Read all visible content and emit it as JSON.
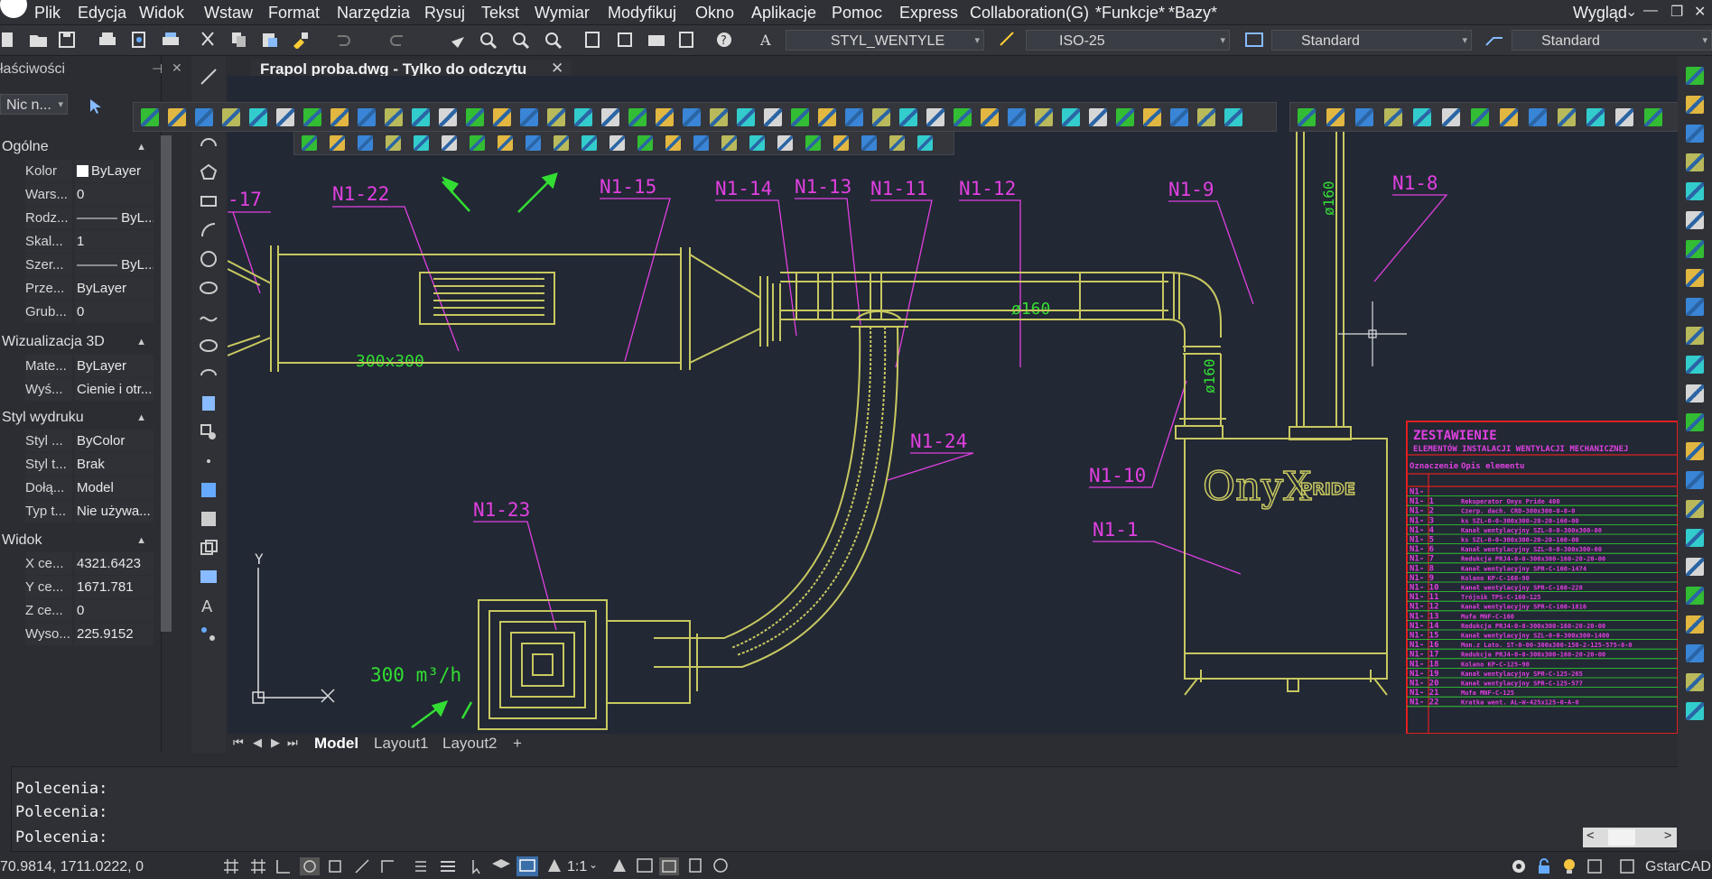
{
  "menu": {
    "items": [
      "Plik",
      "Edycja",
      "Widok",
      "Wstaw",
      "Format",
      "Narzędzia",
      "Rysuj",
      "Tekst",
      "Wymiar",
      "Modyfikuj",
      "Okno",
      "Aplikacje",
      "Pomoc",
      "Express",
      "Collaboration(G)",
      "*Funkcje*",
      "*Bazy*"
    ],
    "right": "Wygląd"
  },
  "toolbar": {
    "text_style": "STYL_WENTYLE",
    "dim_style": "ISO-25",
    "table_style": "Standard",
    "multileader_style": "Standard"
  },
  "document_tab": {
    "title": "Frapol  proba.dwg - Tylko do odczytu"
  },
  "properties": {
    "title": "łaściwości",
    "selection": "Nic n...",
    "sections": [
      {
        "name": "Ogólne",
        "rows": [
          {
            "k": "Kolor",
            "v": "ByLayer"
          },
          {
            "k": "Wars...",
            "v": "0"
          },
          {
            "k": "Rodz...",
            "v": "——— ByL..."
          },
          {
            "k": "Skal...",
            "v": "1"
          },
          {
            "k": "Szer...",
            "v": "——— ByL..."
          },
          {
            "k": "Prze...",
            "v": "ByLayer"
          },
          {
            "k": "Grub...",
            "v": "0"
          }
        ]
      },
      {
        "name": "Wizualizacja 3D",
        "rows": [
          {
            "k": "Mate...",
            "v": "ByLayer"
          },
          {
            "k": "Wyś...",
            "v": "Cienie i otr..."
          }
        ]
      },
      {
        "name": "Styl wydruku",
        "rows": [
          {
            "k": "Styl ...",
            "v": "ByColor"
          },
          {
            "k": "Styl t...",
            "v": "Brak"
          },
          {
            "k": "Dołą...",
            "v": "Model"
          },
          {
            "k": "Typ t...",
            "v": "Nie używa..."
          }
        ]
      },
      {
        "name": "Widok",
        "rows": [
          {
            "k": "X ce...",
            "v": "4321.6423"
          },
          {
            "k": "Y ce...",
            "v": "1671.781"
          },
          {
            "k": "Z ce...",
            "v": "0"
          },
          {
            "k": "Wyso...",
            "v": "225.9152"
          }
        ]
      }
    ]
  },
  "drawing": {
    "labels": {
      "n17": "-17",
      "n22": "N1-22",
      "n15": "N1-15",
      "n14": "N1-14",
      "n13": "N1-13",
      "n11": "N1-11",
      "n12": "N1-12",
      "n9": "N1-9",
      "n8": "N1-8",
      "n24": "N1-24",
      "n23": "N1-23",
      "n10": "N1-10",
      "n1": "N1-1"
    },
    "dims": {
      "duct1": "300x300",
      "d160a": "ø160",
      "d160b": "ø160",
      "d160c": "ø160",
      "flow": "300 m³/h"
    },
    "brand": {
      "a": "OnyX",
      "b": "PRIDE"
    },
    "axes": {
      "y": "Y"
    },
    "table": {
      "title": "ZESTAWIENIE",
      "subtitle": "ELEMENTÓW INSTALACJI WENTYLACJI MECHANICZNEJ",
      "head_a": "Oznaczenie",
      "head_b": "Opis elementu",
      "rows": [
        {
          "id": "N1-",
          "desc": ""
        },
        {
          "id": "N1- 1",
          "desc": "Rekuperator Onyx Pride 400"
        },
        {
          "id": "N1- 2",
          "desc": "Czerp. dach. CRD-300x300-0-0-0"
        },
        {
          "id": "N1- 3",
          "desc": "ks SZL-0-0-300x300-20-20-160-00"
        },
        {
          "id": "N1- 4",
          "desc": "Kanał wentylacyjny SZL-0-0-300x300-00"
        },
        {
          "id": "N1- 5",
          "desc": "ks SZL-0-0-300x300-20-20-160-00"
        },
        {
          "id": "N1- 6",
          "desc": "Kanał wentylacyjny SZL-0-0-300x300-00"
        },
        {
          "id": "N1- 7",
          "desc": "Redukcja PRJ4-0-0-300x300-160-20-20-00"
        },
        {
          "id": "N1- 8",
          "desc": "Kanał wentylacyjny SPR-C-160-1474"
        },
        {
          "id": "N1- 9",
          "desc": "Kolano KP-C-160-90"
        },
        {
          "id": "N1- 10",
          "desc": "Kanał wentylacyjny SPR-C-160-228"
        },
        {
          "id": "N1- 11",
          "desc": "Trójnik TPS-C-160-125"
        },
        {
          "id": "N1- 12",
          "desc": "Kanał wentylacyjny SPR-C-160-1816"
        },
        {
          "id": "N1- 13",
          "desc": "Mufa MNF-C-160"
        },
        {
          "id": "N1- 14",
          "desc": "Redukcja PRJ4-0-0-300x300-160-20-20-00"
        },
        {
          "id": "N1- 15",
          "desc": "Kanał wentylacyjny SZL-0-0-300x300-1400"
        },
        {
          "id": "N1- 16",
          "desc": "Mon.z Lato. ST-0-00-300x300-150-2-125-575-0-0"
        },
        {
          "id": "N1- 17",
          "desc": "Redukcja PRJ4-0-0-300x300-160-20-20-00"
        },
        {
          "id": "N1- 18",
          "desc": "Kolano KP-C-125-90"
        },
        {
          "id": "N1- 19",
          "desc": "Kanał wentylacyjny SPR-C-125-265"
        },
        {
          "id": "N1- 20",
          "desc": "Kanał wentylacyjny SPR-C-125-577"
        },
        {
          "id": "N1- 21",
          "desc": "Mufa MNF-C-125"
        },
        {
          "id": "N1- 22",
          "desc": "Kratka went. AL-W-425x125-0-A-0"
        }
      ]
    }
  },
  "layout_tabs": [
    "Model",
    "Layout1",
    "Layout2",
    "+"
  ],
  "command": {
    "lines": [
      "Polecenia:",
      "Polecenia:",
      "Polecenia:"
    ]
  },
  "status": {
    "coords": "70.9814, 1711.0222, 0",
    "scale": "1:1",
    "app": "GstarCAD"
  },
  "colors": {
    "magenta": "#e040e0",
    "olive": "#c8c860",
    "green": "#33dd33",
    "background": "#222834",
    "table_red": "#e02020"
  }
}
